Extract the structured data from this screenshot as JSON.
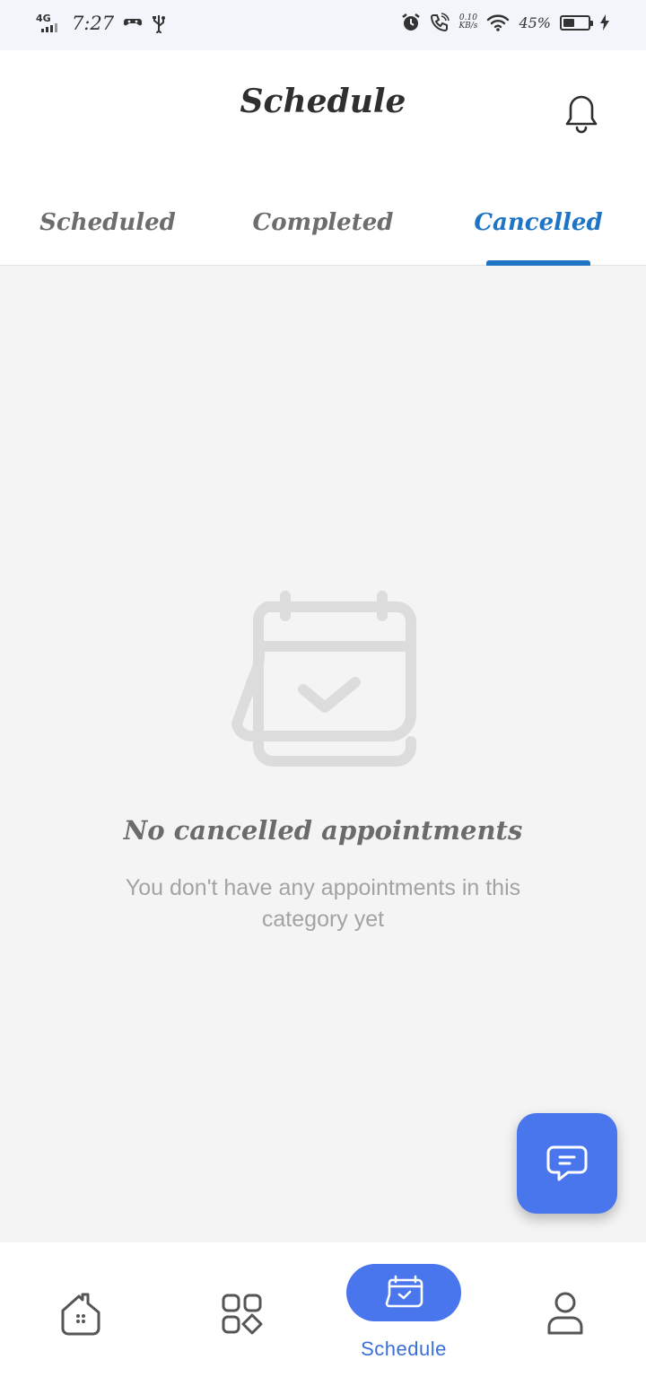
{
  "status_bar": {
    "network": "4G",
    "time": "7:27",
    "speed_value": "0.10",
    "speed_unit": "KB/s",
    "battery_percent": "45%",
    "battery_level": 0.45
  },
  "header": {
    "title": "Schedule"
  },
  "tabs": [
    {
      "label": "Scheduled",
      "active": false
    },
    {
      "label": "Completed",
      "active": false
    },
    {
      "label": "Cancelled",
      "active": true
    }
  ],
  "empty_state": {
    "title": "No cancelled appointments",
    "subtitle": "You don't have any appointments in this category yet"
  },
  "bottom_nav": {
    "items": [
      {
        "icon": "home-icon"
      },
      {
        "icon": "apps-grid-icon"
      },
      {
        "icon": "calendar-check-icon",
        "label": "Schedule",
        "active": true
      },
      {
        "icon": "person-icon"
      }
    ]
  },
  "colors": {
    "accent": "#1f74c4",
    "primary_button": "#4a76ed",
    "background": "#f4f4f4",
    "illustration": "#dcdcdc"
  }
}
